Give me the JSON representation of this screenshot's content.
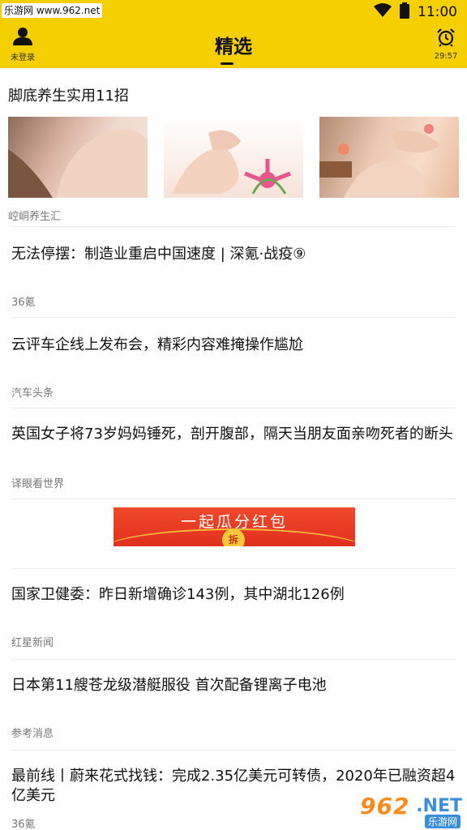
{
  "status_bar": {
    "watermark": "乐游网 www.962.net",
    "time": "11:00",
    "icons": [
      "wifi-icon",
      "battery-icon"
    ]
  },
  "header": {
    "user_label": "未登录",
    "title": "精选",
    "alarm_time": "29:57",
    "icons": [
      "user-icon",
      "alarm-clock-icon"
    ],
    "accent_color": "#f5cf00"
  },
  "feed": {
    "gallery": {
      "title": "脚底养生实用11招",
      "source": "崆峒养生汇",
      "images": [
        "foot-massage-image",
        "feet-lily-image",
        "foot-spa-image"
      ]
    },
    "items": [
      {
        "headline": "无法停摆：制造业重启中国速度 | 深氪·战疫⑨",
        "source": "36氪"
      },
      {
        "headline": "云评车企线上发布会，精彩内容难掩操作尴尬",
        "source": "汽车头条"
      },
      {
        "headline": "英国女子将73岁妈妈锤死，剖开腹部，隔天当朋友面亲吻死者的断头",
        "source": "译眼看世界"
      }
    ],
    "ad": {
      "text": "一起瓜分红包",
      "coin_label": "拆"
    },
    "items_after_ad": [
      {
        "headline": "国家卫健委：昨日新增确诊143例，其中湖北126例",
        "source": "红星新闻"
      },
      {
        "headline": "日本第11艘苍龙级潜艇服役 首次配备锂离子电池",
        "source": "参考消息"
      },
      {
        "headline": "最前线丨蔚来花式找钱：完成2.35亿美元可转债，2020年已融资超4亿美元",
        "source": "36氪"
      }
    ]
  },
  "watermark_bottom": {
    "number": "962",
    "suffix": ".NET",
    "label": "乐游网"
  }
}
